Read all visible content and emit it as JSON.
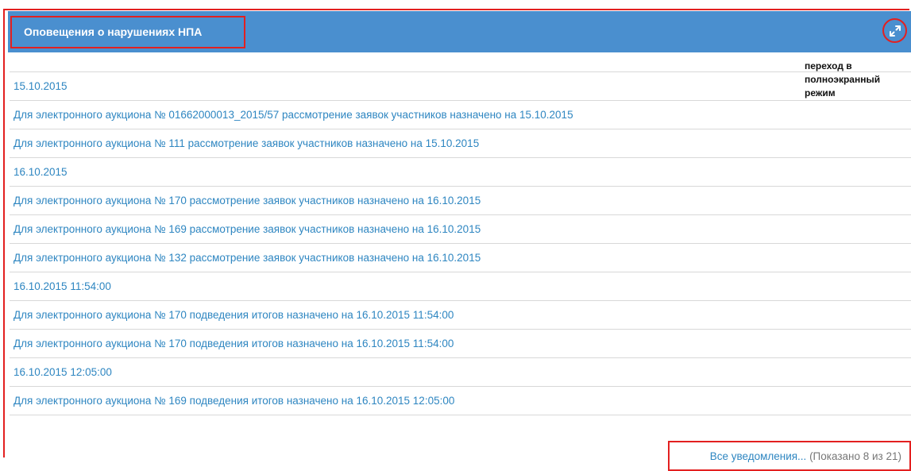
{
  "panel": {
    "title": "Оповещения о нарушениях НПА",
    "annotation": "переход в полноэкранный режим"
  },
  "rows": [
    {
      "type": "date",
      "text": "15.10.2015"
    },
    {
      "type": "item",
      "text": "Для электронного аукциона № 01662000013_2015/57 рассмотрение заявок участников назначено на 15.10.2015"
    },
    {
      "type": "item",
      "text": "Для электронного аукциона № 111 рассмотрение заявок участников назначено на 15.10.2015"
    },
    {
      "type": "date",
      "text": "16.10.2015"
    },
    {
      "type": "item",
      "text": "Для электронного аукциона № 170 рассмотрение заявок участников назначено на 16.10.2015"
    },
    {
      "type": "item",
      "text": "Для электронного аукциона № 169 рассмотрение заявок участников назначено на 16.10.2015"
    },
    {
      "type": "item",
      "text": "Для электронного аукциона № 132 рассмотрение заявок участников назначено на 16.10.2015"
    },
    {
      "type": "date",
      "text": "16.10.2015 11:54:00"
    },
    {
      "type": "item",
      "text": "Для электронного аукциона № 170 подведения итогов назначено на 16.10.2015 11:54:00"
    },
    {
      "type": "item",
      "text": "Для электронного аукциона № 170 подведения итогов назначено на 16.10.2015 11:54:00"
    },
    {
      "type": "date",
      "text": "16.10.2015 12:05:00"
    },
    {
      "type": "item",
      "text": "Для электронного аукциона № 169 подведения итогов назначено на 16.10.2015 12:05:00"
    }
  ],
  "footer": {
    "all_link": "Все уведомления...",
    "shown": " (Показано 8 из 21)"
  },
  "icons": {
    "expand": "expand-icon"
  },
  "colors": {
    "header": "#4a8fcf",
    "link": "#2e86c1",
    "highlight": "#e32020"
  }
}
